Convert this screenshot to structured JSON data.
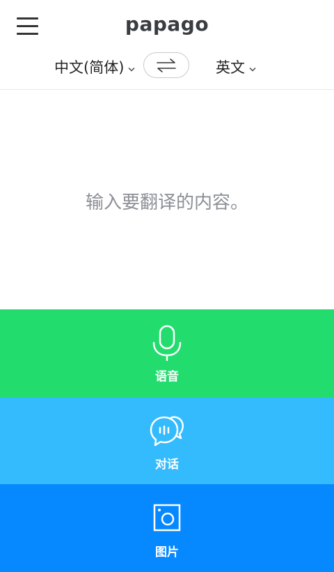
{
  "brand": "papago",
  "colors": {
    "voice": "#23dc6e",
    "conversation": "#34bbfe",
    "image": "#0688ff"
  },
  "languages": {
    "source": "中文(简体)",
    "target": "英文"
  },
  "input": {
    "placeholder": "输入要翻译的内容。"
  },
  "panels": {
    "voice_label": "语音",
    "conversation_label": "对话",
    "image_label": "图片"
  },
  "icons": {
    "menu": "hamburger-menu-icon",
    "swap": "swap-arrows-icon",
    "caret": "chevron-down-icon",
    "voice": "microphone-icon",
    "conversation": "chat-bubbles-icon",
    "image": "camera-icon"
  }
}
